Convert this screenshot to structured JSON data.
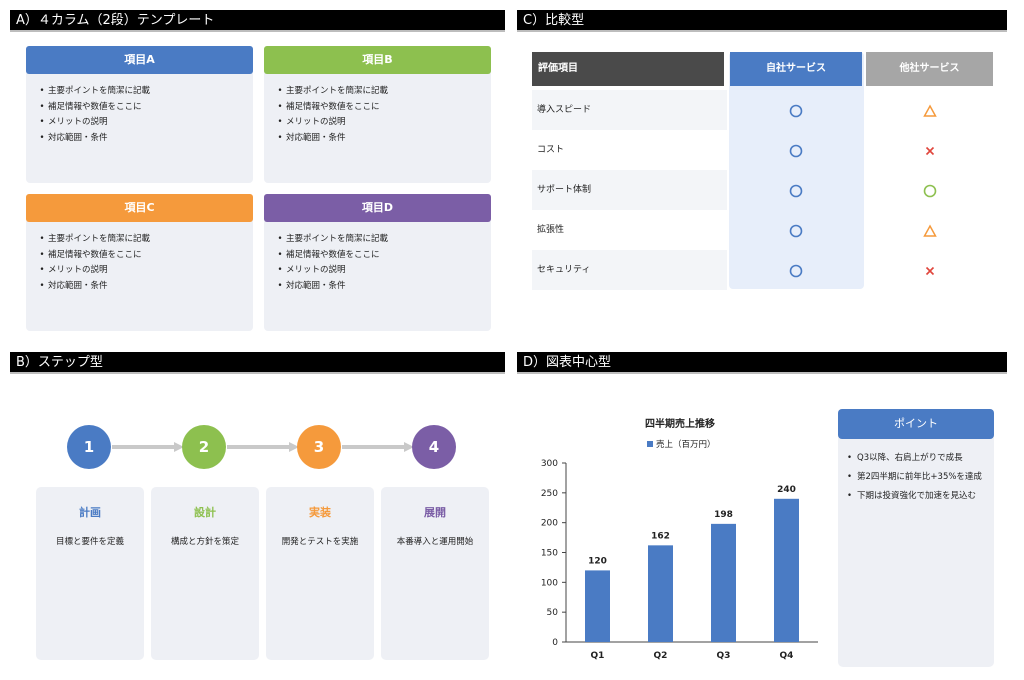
{
  "sections": {
    "a": "A）４カラム（2段）テンプレート",
    "b": "B）ステップ型",
    "c": "C）比較型",
    "d": "D）図表中心型"
  },
  "columns": [
    {
      "title": "項目A",
      "color": "#4a7bc4",
      "bullets": [
        "主要ポイントを簡潔に記載",
        "補足情報や数値をここに",
        "メリットの説明",
        "対応範囲・条件"
      ]
    },
    {
      "title": "項目B",
      "color": "#8dc04f",
      "bullets": [
        "主要ポイントを簡潔に記載",
        "補足情報や数値をここに",
        "メリットの説明",
        "対応範囲・条件"
      ]
    },
    {
      "title": "項目C",
      "color": "#f59a3c",
      "bullets": [
        "主要ポイントを簡潔に記載",
        "補足情報や数値をここに",
        "メリットの説明",
        "対応範囲・条件"
      ]
    },
    {
      "title": "項目D",
      "color": "#7b5ea6",
      "bullets": [
        "主要ポイントを簡潔に記載",
        "補足情報や数値をここに",
        "メリットの説明",
        "対応範囲・条件"
      ]
    }
  ],
  "comparison": {
    "headers": {
      "criteria": "評価項目",
      "own": "自社サービス",
      "other": "他社サービス"
    },
    "rows": [
      {
        "label": "導入スピード",
        "own": "circle",
        "other": "triangle"
      },
      {
        "label": "コスト",
        "own": "circle",
        "other": "cross"
      },
      {
        "label": "サポート体制",
        "own": "circle",
        "other": "circle"
      },
      {
        "label": "拡張性",
        "own": "circle",
        "other": "triangle"
      },
      {
        "label": "セキュリティ",
        "own": "circle",
        "other": "cross"
      }
    ],
    "colors": {
      "own": "#4a7bc4",
      "triangle": "#f59a3c",
      "cross": "#e0453c",
      "other_circle": "#8dc04f",
      "header_dark": "#4a4a4a",
      "header_gray": "#a6a6a6"
    }
  },
  "steps": [
    {
      "number": "1",
      "title": "計画",
      "desc": "目標と要件を定義",
      "color": "#4a7bc4"
    },
    {
      "number": "2",
      "title": "設計",
      "desc": "構成と方針を策定",
      "color": "#8dc04f"
    },
    {
      "number": "3",
      "title": "実装",
      "desc": "開発とテストを実施",
      "color": "#f59a3c"
    },
    {
      "number": "4",
      "title": "展開",
      "desc": "本番導入と運用開始",
      "color": "#7b5ea6"
    }
  ],
  "chart_data": {
    "type": "bar",
    "title": "四半期売上推移",
    "categories": [
      "Q1",
      "Q2",
      "Q3",
      "Q4"
    ],
    "series": [
      {
        "name": "売上（百万円）",
        "values": [
          120,
          162,
          198,
          240
        ]
      }
    ],
    "ylim": [
      0,
      300
    ],
    "yticks": [
      0,
      50,
      100,
      150,
      200,
      250,
      300
    ],
    "grid": false,
    "legend": "top",
    "color": "#4a7bc4"
  },
  "points": {
    "title": "ポイント",
    "items": [
      "Q3以降、右肩上がりで成長",
      "第2四半期に前年比+35%を達成",
      "下期は投資強化で加速を見込む"
    ]
  }
}
